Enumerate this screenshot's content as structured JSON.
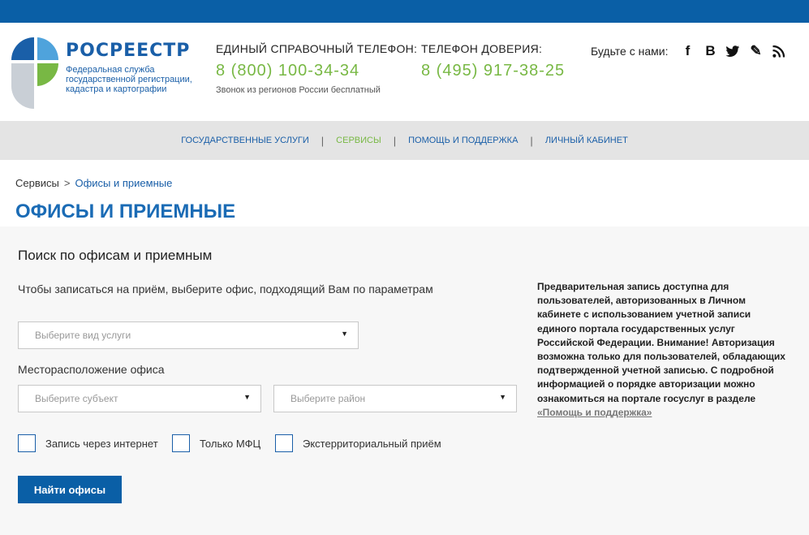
{
  "brand": {
    "name": "РОСРЕЕСТР",
    "subtitle": "Федеральная служба государственной регистрации, кадастра и картографии"
  },
  "phones": [
    {
      "title": "ЕДИНЫЙ СПРАВОЧНЫЙ ТЕЛЕФОН:",
      "number": "8 (800) 100-34-34",
      "note": "Звонок из регионов России бесплатный"
    },
    {
      "title": "ТЕЛЕФОН ДОВЕРИЯ:",
      "number": "8 (495) 917-38-25",
      "note": ""
    }
  ],
  "social": {
    "label": "Будьте с нами:",
    "icons": [
      "facebook-icon",
      "vkontakte-icon",
      "twitter-icon",
      "livejournal-icon",
      "rss-icon"
    ],
    "glyphs": [
      "f",
      "B",
      "t",
      "✎",
      "≋"
    ]
  },
  "nav": {
    "items": [
      "ГОСУДАРСТВЕННЫЕ УСЛУГИ",
      "СЕРВИСЫ",
      "ПОМОЩЬ И ПОДДЕРЖКА",
      "ЛИЧНЫЙ КАБИНЕТ"
    ],
    "active": "СЕРВИСЫ"
  },
  "breadcrumb": {
    "root": "Сервисы",
    "separator": ">",
    "current": "Офисы и приемные"
  },
  "page_title": "ОФИСЫ И ПРИЕМНЫЕ",
  "search": {
    "title": "Поиск по офисам и приемным",
    "hint": "Чтобы записаться на приём, выберите офис, подходящий Вам по параметрам",
    "service_placeholder": "Выберите вид услуги",
    "location_label": "Месторасположение офиса",
    "subject_placeholder": "Выберите субъект",
    "district_placeholder": "Выберите район",
    "checkboxes": [
      "Запись через интернет",
      "Только МФЦ",
      "Экстерриториальный приём"
    ],
    "button": "Найти офисы"
  },
  "notice": {
    "text": "Предварительная запись доступна для пользователей, авторизованных в Личном кабинете с использованием учетной записи единого портала государственных услуг Российской Федерации. Внимание! Авторизация возможна только для пользователей, обладающих подтвержденной учетной записью. С подробной информацией о порядке авторизации можно ознакомиться на портале госуслуг в разделе ",
    "link": "«Помощь и поддержка»"
  },
  "colors": {
    "brand_blue": "#0a5fa6",
    "accent_green": "#78b844",
    "nav_bg": "#e4e4e4",
    "panel_bg": "#f7f7f7"
  }
}
